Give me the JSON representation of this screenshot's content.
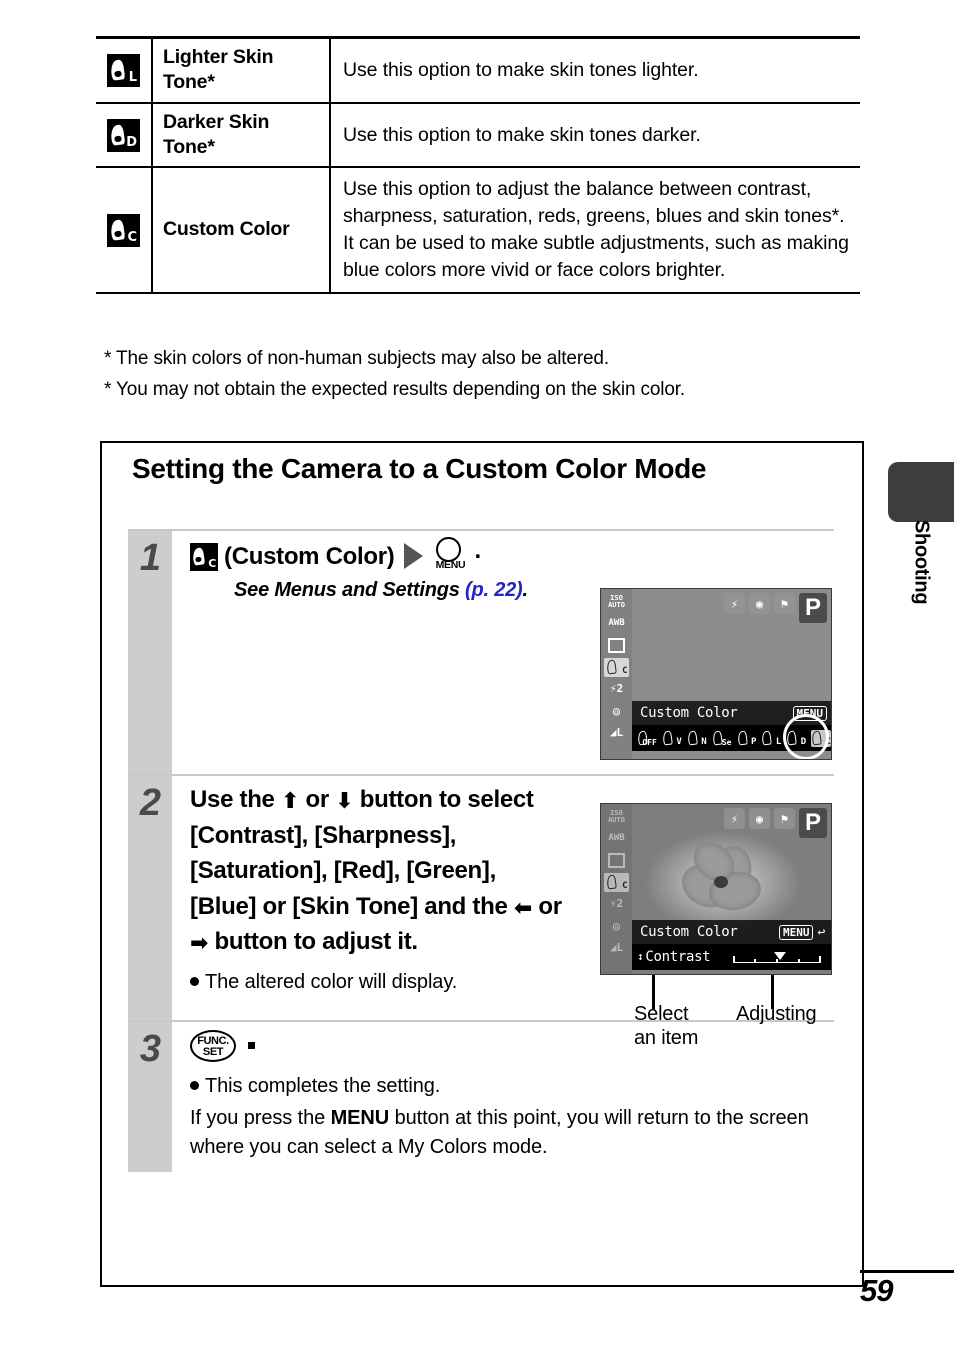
{
  "top_table": {
    "rows": [
      {
        "icon_letter": "L",
        "icon_name": "lighter-skin-tone-icon",
        "name": "Lighter Skin Tone*",
        "description": "Use this option to make skin tones lighter."
      },
      {
        "icon_letter": "D",
        "icon_name": "darker-skin-tone-icon",
        "name": "Darker Skin Tone*",
        "description": "Use this option to make skin tones darker."
      },
      {
        "icon_letter": "C",
        "icon_name": "custom-color-icon",
        "name": "Custom Color",
        "description": "Use this option to adjust the balance between contrast, sharpness, saturation, reds, greens, blues and skin tones*. It can be used to make subtle adjustments, such as making blue colors more vivid or face colors brighter."
      }
    ]
  },
  "footnotes": [
    "* The skin colors of non-human subjects may also be altered.",
    "* You may not obtain the expected results depending on the skin color."
  ],
  "main": {
    "title": "Setting the Camera to a Custom Color Mode",
    "steps": [
      {
        "num": "1",
        "icon_letter": "C",
        "label": "(Custom Color)",
        "menu_button_label": "MENU",
        "period": ".",
        "see_prefix": "See Menus and Settings ",
        "see_ref": "(p. 22)",
        "see_suffix": "."
      },
      {
        "num": "2",
        "text_1": "Use the ",
        "text_2": " or ",
        "text_3": " button to select [Contrast], [Sharpness], [Saturation], [Red], [Green], [Blue] or [Skin Tone] and the ",
        "text_4": " or ",
        "text_5": " button to adjust it.",
        "bullet": "The altered color will display."
      },
      {
        "num": "3",
        "func_top": "FUNC.",
        "func_bottom": "SET",
        "bullet": "This completes the setting.",
        "para_1": "If you press the ",
        "para_menu": "MENU",
        "para_2": " button at this point, you will return to the screen where you can select a My Colors mode."
      }
    ]
  },
  "lcd1": {
    "name": "camera-lcd-custom-color-select",
    "left_icons": [
      {
        "name": "iso-auto-icon",
        "top": "ISO",
        "bottom": "AUTO"
      },
      {
        "name": "white-balance-icon",
        "label": "AWB"
      },
      {
        "name": "drive-mode-single-icon",
        "label": "□"
      },
      {
        "name": "my-colors-custom-icon",
        "label": "C",
        "selected": true
      },
      {
        "name": "flash-exposure-icon",
        "label": "2"
      },
      {
        "name": "metering-icon",
        "label": "◎"
      },
      {
        "name": "image-quality-icon",
        "label": "L"
      }
    ],
    "top_icons": [
      {
        "name": "flash-off-icon",
        "glyph": "⚡"
      },
      {
        "name": "metering-mode-icon",
        "glyph": "◉"
      },
      {
        "name": "macro-mode-icon",
        "glyph": "⚑"
      }
    ],
    "mode": "P",
    "menu_title": "Custom Color",
    "menu_tag": "MENU",
    "options": [
      {
        "label": "OFF",
        "selected": false
      },
      {
        "label": "V",
        "selected": false
      },
      {
        "label": "N",
        "selected": false
      },
      {
        "label": "Se",
        "selected": false
      },
      {
        "label": "P",
        "selected": false
      },
      {
        "label": "L",
        "selected": false
      },
      {
        "label": "D",
        "selected": false
      },
      {
        "label": "C",
        "selected": true
      }
    ]
  },
  "lcd2": {
    "name": "camera-lcd-contrast-adjust",
    "mode": "P",
    "menu_title": "Custom Color",
    "menu_tag": "MENU",
    "return_arrow": "↩",
    "item_label": "Contrast",
    "updown_glyph": "↕",
    "slider_value": 0
  },
  "callouts": {
    "select": "Select\nan item",
    "select_line1": "Select",
    "select_line2": "an item",
    "adjusting": "Adjusting"
  },
  "side_tab": {
    "label": "Shooting"
  },
  "page_number": "59",
  "colors": {
    "link_blue": "#2222cc",
    "step_gray": "#cdcdcd",
    "step_num_gray": "#4a4a4a",
    "tab_dark": "#3d3d3d"
  }
}
